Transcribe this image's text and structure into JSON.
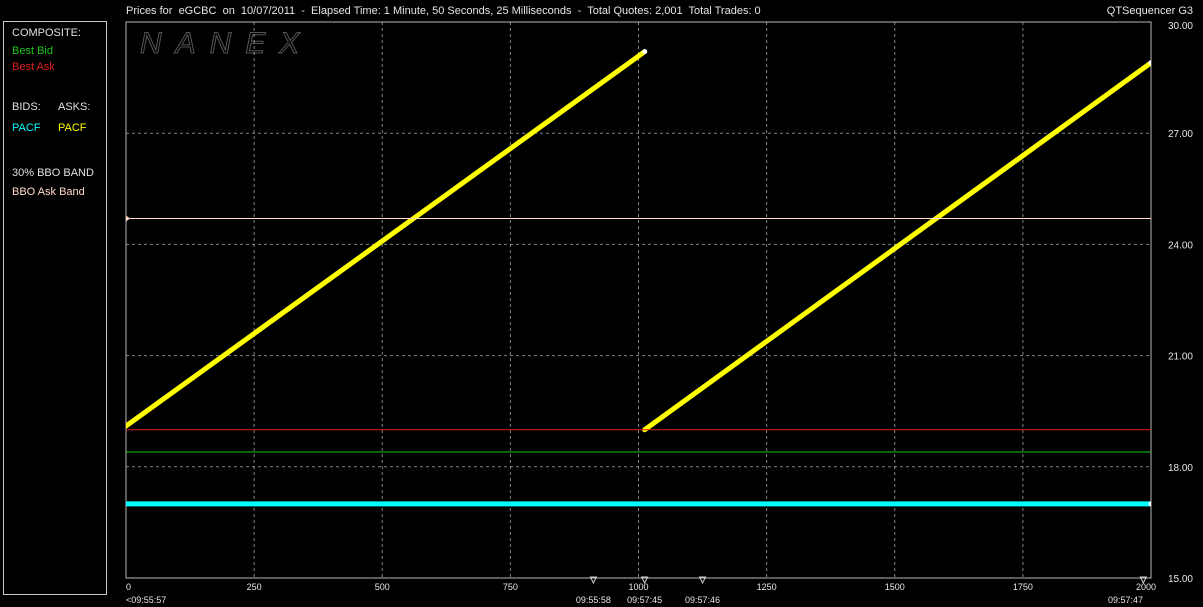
{
  "header": {
    "title": "Prices for  eGCBC  on  10/07/2011  -  Elapsed Time: 1 Minute, 50 Seconds, 25 Milliseconds  -  Total Quotes: 2,001  Total Trades: 0",
    "app_name": "QTSequencer G3"
  },
  "watermark": "NANEX",
  "legend": {
    "composite_label": "COMPOSITE:",
    "best_bid": "Best Bid",
    "best_ask": "Best Ask",
    "bids_label": "BIDS:",
    "asks_label": "ASKS:",
    "bid_exchange": "PACF",
    "ask_exchange": "PACF",
    "band_label": "30% BBO BAND",
    "band_item": "BBO Ask Band"
  },
  "colors": {
    "best_bid": "#1ec81e",
    "best_ask": "#e01e1e",
    "pacf_bid": "#00ffff",
    "pacf_ask": "#ffff00",
    "bbo_ask_band": "#ffd8c8",
    "grid": "#bbbbbb"
  },
  "chart_data": {
    "type": "line",
    "xlim": [
      0,
      2000
    ],
    "ylim": [
      15.0,
      30.0
    ],
    "x_ticks": [
      0,
      250,
      500,
      750,
      1000,
      1250,
      1500,
      1750,
      2000
    ],
    "y_ticks": [
      "15.00",
      "18.00",
      "21.00",
      "24.00",
      "27.00",
      "30.00"
    ],
    "time_markers": [
      {
        "x": 0,
        "label": "<09:55:57"
      },
      {
        "x": 912,
        "label": "09:55:58"
      },
      {
        "x": 1012,
        "label": "09:57:45"
      },
      {
        "x": 1125,
        "label": "09:57:46"
      },
      {
        "x": 1985,
        "label": "09:57:47"
      }
    ],
    "series": [
      {
        "name": "PACF",
        "role": "ask",
        "segments": [
          [
            [
              0,
              19.1
            ],
            [
              1012,
              29.2
            ]
          ],
          [
            [
              1012,
              19.0
            ],
            [
              2000,
              28.9
            ]
          ]
        ]
      },
      {
        "name": "PACF",
        "role": "bid",
        "segments": [
          [
            [
              0,
              17.0
            ],
            [
              2000,
              17.0
            ]
          ]
        ]
      },
      {
        "name": "Best Ask",
        "segments": [
          [
            [
              0,
              19.0
            ],
            [
              2000,
              19.0
            ]
          ]
        ]
      },
      {
        "name": "Best Bid",
        "segments": [
          [
            [
              0,
              18.4
            ],
            [
              2000,
              18.4
            ]
          ]
        ]
      },
      {
        "name": "BBO Ask Band",
        "segments": [
          [
            [
              0,
              24.7
            ],
            [
              2000,
              24.7
            ]
          ]
        ]
      }
    ]
  }
}
